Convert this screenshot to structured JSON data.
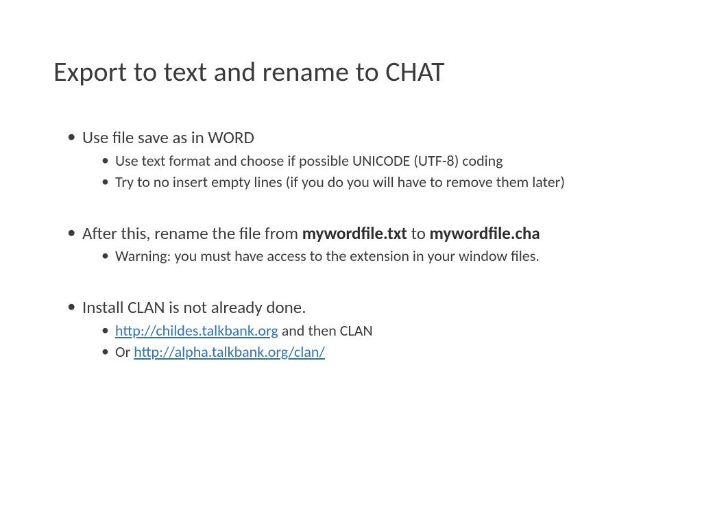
{
  "title": "Export to text and rename to CHAT",
  "bullets": {
    "b1": {
      "text": "Use file save as in WORD",
      "sub": [
        "Use text format and choose if possible UNICODE (UTF-8) coding",
        "Try to no insert empty lines (if you do you will have to remove them later)"
      ]
    },
    "b2": {
      "prefix": "After this, rename the file from ",
      "bold1": "mywordfile.txt",
      "mid": " to ",
      "bold2": "mywordfile.cha",
      "sub": [
        "Warning: you must have access to the extension in your window files."
      ]
    },
    "b3": {
      "text": "Install CLAN is not already done.",
      "sub1_link": "http://childes.talkbank.org",
      "sub1_tail": " and then CLAN",
      "sub2_prefix": "Or ",
      "sub2_link": "http://alpha.talkbank.org/clan/"
    }
  }
}
